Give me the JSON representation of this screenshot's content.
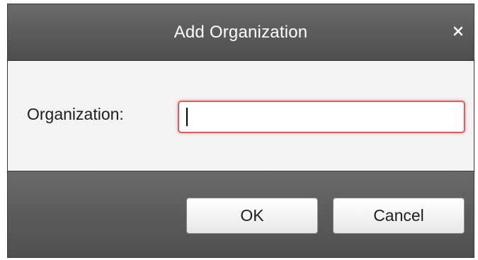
{
  "dialog": {
    "title": "Add Organization",
    "close_icon": "close-icon"
  },
  "form": {
    "organization_label": "Organization:",
    "organization_value": ""
  },
  "buttons": {
    "ok_label": "OK",
    "cancel_label": "Cancel"
  },
  "colors": {
    "titlebar": "#5d5d5d",
    "content_bg": "#f3f3f3",
    "input_focus_border": "#d85f63",
    "text": "#1e1e1e"
  }
}
